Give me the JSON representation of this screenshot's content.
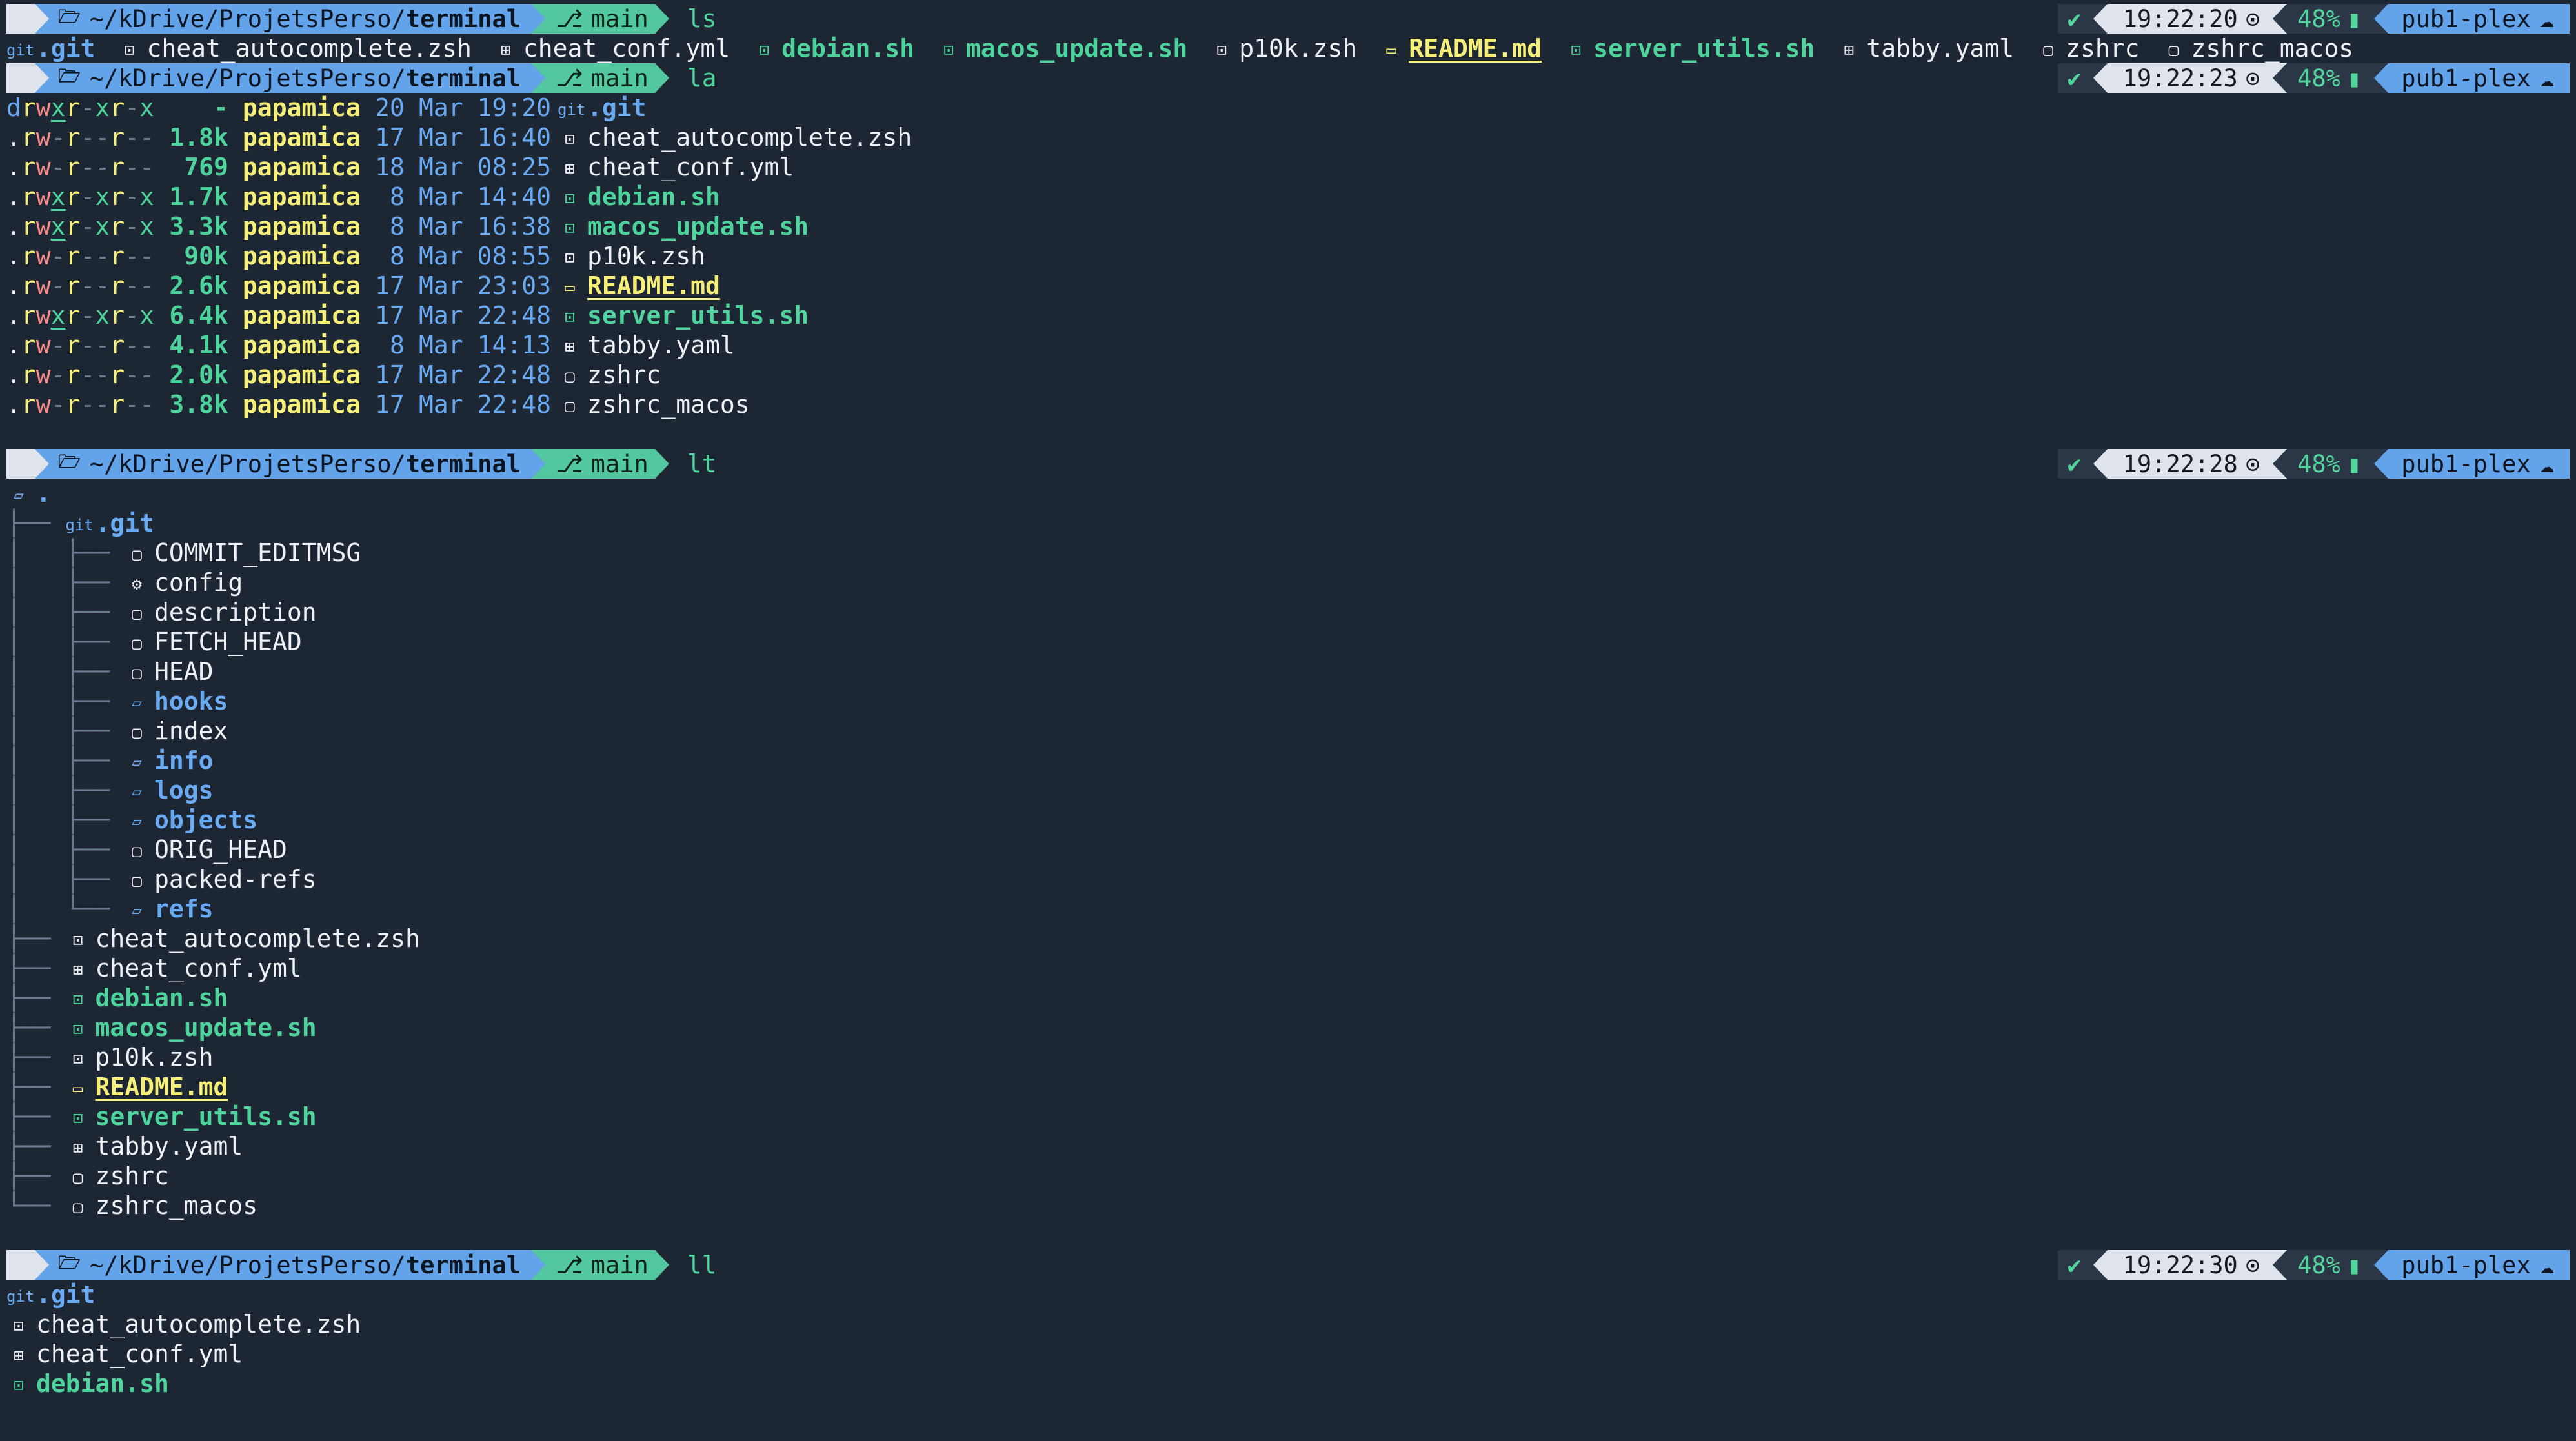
{
  "prompt": {
    "apple": "",
    "folder_icon": "🗁",
    "path_dim": "~/kDrive/ProjetsPerso/",
    "path_bold": "terminal",
    "git_icon": "⎇",
    "branch": "main",
    "status_ok": "✔",
    "clock_icon": "⊙",
    "battery": "48%",
    "battery_icon": "▮",
    "host": "pub1-plex",
    "cloud_icon": "☁"
  },
  "commands": [
    {
      "cmd": "ls",
      "time": "19:22:20"
    },
    {
      "cmd": "la",
      "time": "19:22:23"
    },
    {
      "cmd": "lt",
      "time": "19:22:28"
    },
    {
      "cmd": "ll",
      "time": "19:22:30"
    }
  ],
  "icons": {
    "git": "git",
    "script": "⊡",
    "config": "⊞",
    "markdown": "▭",
    "file": "▢",
    "folder": "▱",
    "gear": "⚙"
  },
  "ls_output": [
    {
      "name": ".git",
      "type": "git"
    },
    {
      "name": "cheat_autocomplete.zsh",
      "type": "script"
    },
    {
      "name": "cheat_conf.yml",
      "type": "config"
    },
    {
      "name": "debian.sh",
      "type": "exec"
    },
    {
      "name": "macos_update.sh",
      "type": "exec"
    },
    {
      "name": "p10k.zsh",
      "type": "script"
    },
    {
      "name": "README.md",
      "type": "markdown"
    },
    {
      "name": "server_utils.sh",
      "type": "exec"
    },
    {
      "name": "tabby.yaml",
      "type": "config"
    },
    {
      "name": "zshrc",
      "type": "file"
    },
    {
      "name": "zshrc_macos",
      "type": "file"
    }
  ],
  "la_output": [
    {
      "perm": "drwxr-xr-x",
      "size": "-",
      "user": "papamica",
      "day": "20",
      "mon": "Mar",
      "time": "19:20",
      "name": ".git",
      "type": "git"
    },
    {
      "perm": ".rw-r--r--",
      "size": "1.8k",
      "user": "papamica",
      "day": "17",
      "mon": "Mar",
      "time": "16:40",
      "name": "cheat_autocomplete.zsh",
      "type": "script"
    },
    {
      "perm": ".rw-r--r--",
      "size": "769",
      "user": "papamica",
      "day": "18",
      "mon": "Mar",
      "time": "08:25",
      "name": "cheat_conf.yml",
      "type": "config"
    },
    {
      "perm": ".rwxr-xr-x",
      "size": "1.7k",
      "user": "papamica",
      "day": "8",
      "mon": "Mar",
      "time": "14:40",
      "name": "debian.sh",
      "type": "exec"
    },
    {
      "perm": ".rwxr-xr-x",
      "size": "3.3k",
      "user": "papamica",
      "day": "8",
      "mon": "Mar",
      "time": "16:38",
      "name": "macos_update.sh",
      "type": "exec"
    },
    {
      "perm": ".rw-r--r--",
      "size": "90k",
      "user": "papamica",
      "day": "8",
      "mon": "Mar",
      "time": "08:55",
      "name": "p10k.zsh",
      "type": "script"
    },
    {
      "perm": ".rw-r--r--",
      "size": "2.6k",
      "user": "papamica",
      "day": "17",
      "mon": "Mar",
      "time": "23:03",
      "name": "README.md",
      "type": "markdown"
    },
    {
      "perm": ".rwxr-xr-x",
      "size": "6.4k",
      "user": "papamica",
      "day": "17",
      "mon": "Mar",
      "time": "22:48",
      "name": "server_utils.sh",
      "type": "exec"
    },
    {
      "perm": ".rw-r--r--",
      "size": "4.1k",
      "user": "papamica",
      "day": "8",
      "mon": "Mar",
      "time": "14:13",
      "name": "tabby.yaml",
      "type": "config"
    },
    {
      "perm": ".rw-r--r--",
      "size": "2.0k",
      "user": "papamica",
      "day": "17",
      "mon": "Mar",
      "time": "22:48",
      "name": "zshrc",
      "type": "file"
    },
    {
      "perm": ".rw-r--r--",
      "size": "3.8k",
      "user": "papamica",
      "day": "17",
      "mon": "Mar",
      "time": "22:48",
      "name": "zshrc_macos",
      "type": "file"
    }
  ],
  "lt_root": ".",
  "lt_tree": [
    {
      "prefix": "├── ",
      "name": ".git",
      "type": "git"
    },
    {
      "prefix": "│   ├── ",
      "name": "COMMIT_EDITMSG",
      "type": "file"
    },
    {
      "prefix": "│   ├── ",
      "name": "config",
      "type": "gear"
    },
    {
      "prefix": "│   ├── ",
      "name": "description",
      "type": "file"
    },
    {
      "prefix": "│   ├── ",
      "name": "FETCH_HEAD",
      "type": "file"
    },
    {
      "prefix": "│   ├── ",
      "name": "HEAD",
      "type": "file"
    },
    {
      "prefix": "│   ├── ",
      "name": "hooks",
      "type": "folder"
    },
    {
      "prefix": "│   ├── ",
      "name": "index",
      "type": "file"
    },
    {
      "prefix": "│   ├── ",
      "name": "info",
      "type": "folder"
    },
    {
      "prefix": "│   ├── ",
      "name": "logs",
      "type": "folder"
    },
    {
      "prefix": "│   ├── ",
      "name": "objects",
      "type": "folder"
    },
    {
      "prefix": "│   ├── ",
      "name": "ORIG_HEAD",
      "type": "file"
    },
    {
      "prefix": "│   ├── ",
      "name": "packed-refs",
      "type": "file"
    },
    {
      "prefix": "│   └── ",
      "name": "refs",
      "type": "folder"
    },
    {
      "prefix": "├── ",
      "name": "cheat_autocomplete.zsh",
      "type": "script"
    },
    {
      "prefix": "├── ",
      "name": "cheat_conf.yml",
      "type": "config"
    },
    {
      "prefix": "├── ",
      "name": "debian.sh",
      "type": "exec"
    },
    {
      "prefix": "├── ",
      "name": "macos_update.sh",
      "type": "exec"
    },
    {
      "prefix": "├── ",
      "name": "p10k.zsh",
      "type": "script"
    },
    {
      "prefix": "├── ",
      "name": "README.md",
      "type": "markdown"
    },
    {
      "prefix": "├── ",
      "name": "server_utils.sh",
      "type": "exec"
    },
    {
      "prefix": "├── ",
      "name": "tabby.yaml",
      "type": "config"
    },
    {
      "prefix": "├── ",
      "name": "zshrc",
      "type": "file"
    },
    {
      "prefix": "└── ",
      "name": "zshrc_macos",
      "type": "file"
    }
  ],
  "ll_output": [
    {
      "name": ".git",
      "type": "git"
    },
    {
      "name": "cheat_autocomplete.zsh",
      "type": "script"
    },
    {
      "name": "cheat_conf.yml",
      "type": "config"
    },
    {
      "name": "debian.sh",
      "type": "exec"
    }
  ],
  "colors": {
    "background": "#1d2633",
    "path_segment": "#62a3ea",
    "git_segment": "#52c7a0",
    "directory": "#6aaaf3",
    "executable": "#4ed39c",
    "markdown": "#f6f07a"
  }
}
